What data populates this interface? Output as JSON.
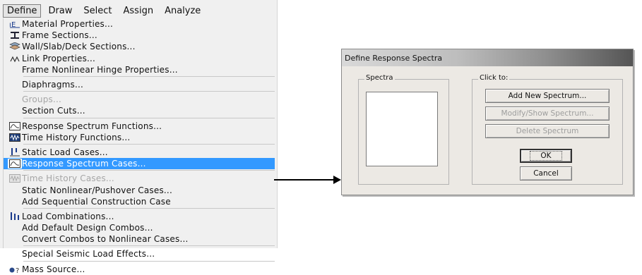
{
  "menubar": [
    {
      "label": "Define",
      "active": true
    },
    {
      "label": "Draw",
      "active": false
    },
    {
      "label": "Select",
      "active": false
    },
    {
      "label": "Assign",
      "active": false
    },
    {
      "label": "Analyze",
      "active": false
    }
  ],
  "menu": {
    "items": [
      {
        "label": "Material Properties...",
        "icon": "material-properties-icon",
        "state": "normal"
      },
      {
        "label": "Frame Sections...",
        "icon": "frame-sections-icon",
        "state": "normal"
      },
      {
        "label": "Wall/Slab/Deck Sections...",
        "icon": "wall-slab-deck-icon",
        "state": "normal"
      },
      {
        "label": "Link Properties...",
        "icon": "link-properties-icon",
        "state": "normal"
      },
      {
        "label": "Frame Nonlinear Hinge Properties...",
        "icon": "",
        "state": "normal"
      },
      {
        "label": "Diaphragms...",
        "icon": "",
        "state": "normal"
      },
      {
        "label": "Groups...",
        "icon": "",
        "state": "disabled"
      },
      {
        "label": "Section Cuts...",
        "icon": "",
        "state": "normal"
      },
      {
        "label": "Response Spectrum Functions...",
        "icon": "response-spectrum-functions-icon",
        "state": "normal"
      },
      {
        "label": "Time History Functions...",
        "icon": "time-history-functions-icon",
        "state": "normal"
      },
      {
        "label": "Static Load Cases...",
        "icon": "static-load-cases-icon",
        "state": "normal"
      },
      {
        "label": "Response Spectrum Cases...",
        "icon": "response-spectrum-cases-icon",
        "state": "selected"
      },
      {
        "label": "Time History Cases...",
        "icon": "time-history-cases-icon",
        "state": "disabled"
      },
      {
        "label": "Static Nonlinear/Pushover Cases...",
        "icon": "",
        "state": "normal"
      },
      {
        "label": "Add Sequential Construction Case",
        "icon": "",
        "state": "normal"
      },
      {
        "label": "Load Combinations...",
        "icon": "load-combinations-icon",
        "state": "normal"
      },
      {
        "label": "Add Default Design Combos...",
        "icon": "",
        "state": "normal"
      },
      {
        "label": "Convert Combos to Nonlinear Cases...",
        "icon": "",
        "state": "normal"
      },
      {
        "label": "Special Seismic Load Effects...",
        "icon": "",
        "state": "normal"
      },
      {
        "label": "Mass Source...",
        "icon": "mass-source-icon",
        "state": "normal"
      }
    ],
    "separators_after": [
      4,
      5,
      7,
      9,
      11,
      14,
      17,
      18
    ]
  },
  "dialog": {
    "title": "Define Response Spectra",
    "spectra_group_label": "Spectra",
    "click_to_label": "Click to:",
    "add_button": "Add New Spectrum...",
    "modify_button": "Modify/Show Spectrum...",
    "delete_button": "Delete Spectrum",
    "ok_button": "OK",
    "cancel_button": "Cancel"
  },
  "colors": {
    "selection": "#3399ff",
    "disabled_text": "#a6a6a6",
    "dialog_bg": "#ece9e4"
  }
}
